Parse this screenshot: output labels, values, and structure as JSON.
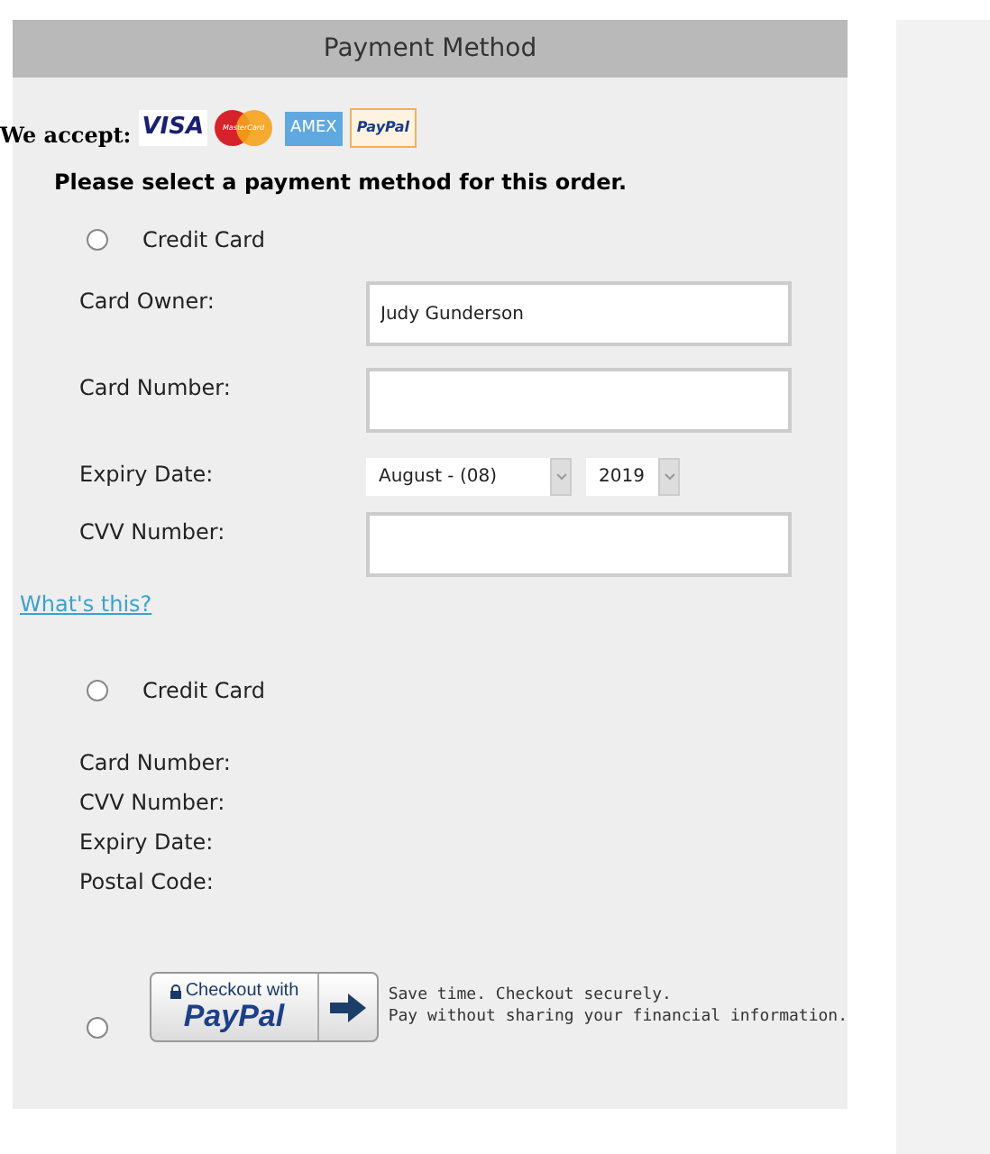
{
  "header": {
    "title": "Payment Method"
  },
  "accepted": {
    "label": "We accept:",
    "cards": [
      {
        "kind": "visa",
        "label": "VISA"
      },
      {
        "kind": "mastercard",
        "label": "MasterCard"
      },
      {
        "kind": "amex",
        "label": "AMEX"
      },
      {
        "kind": "paypal",
        "label": "PayPal"
      }
    ]
  },
  "instruction": "Please select a payment method for this order.",
  "methods": [
    {
      "kind": "card_form",
      "label": "Credit Card",
      "selected": false,
      "fields": [
        {
          "kind": "text",
          "label": "Card Owner:",
          "value": "Judy Gunderson"
        },
        {
          "kind": "text",
          "label": "Card Number:"
        },
        {
          "kind": "expiry",
          "label": "Expiry Date:",
          "month": "August - (08)",
          "year": "2019"
        },
        {
          "kind": "text",
          "label": "CVV Number:"
        }
      ],
      "help_link": "What's this?"
    },
    {
      "kind": "card_summary",
      "label": "Credit Card",
      "selected": false,
      "lines": [
        "Card Number:",
        "CVV Number:",
        "Expiry Date:",
        "Postal Code:"
      ]
    },
    {
      "kind": "paypal",
      "selected": false,
      "button_top": "Checkout with",
      "button_brand": "PayPal",
      "note": [
        "Save time. Checkout securely.",
        "Pay without sharing your financial information."
      ]
    }
  ]
}
